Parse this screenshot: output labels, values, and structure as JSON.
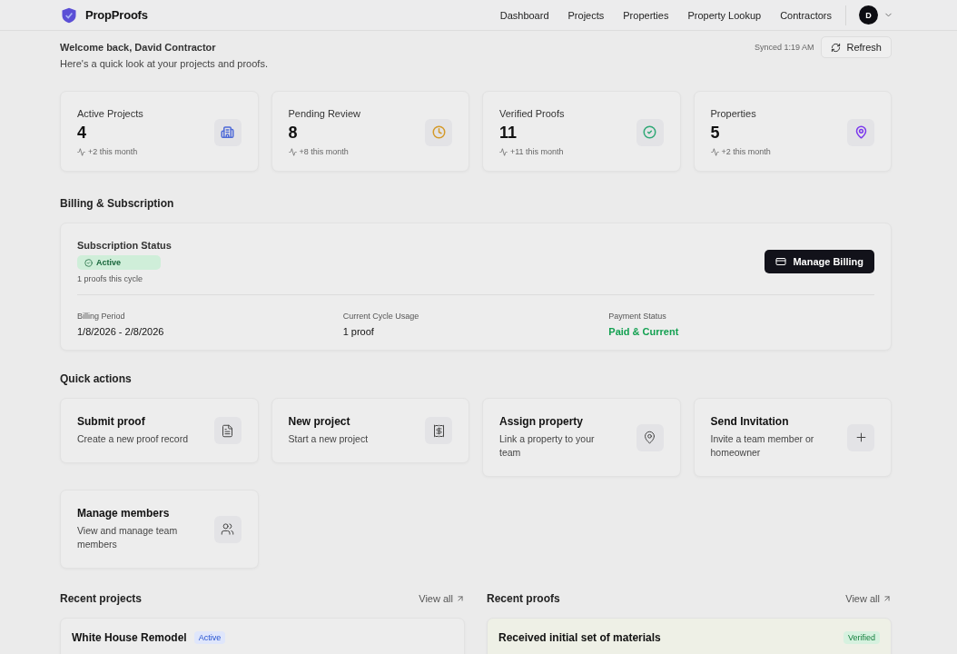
{
  "brand": "PropProofs",
  "nav": [
    {
      "label": "Dashboard"
    },
    {
      "label": "Projects"
    },
    {
      "label": "Properties"
    },
    {
      "label": "Property Lookup"
    },
    {
      "label": "Contractors"
    }
  ],
  "avatar": "D",
  "welcome": {
    "title": "Welcome back, David Contractor",
    "subtitle": "Here's a quick look at your projects and proofs.",
    "synced": "Synced 1:19 AM",
    "refresh": "Refresh"
  },
  "stats": [
    {
      "label": "Active Projects",
      "value": "4",
      "delta": "+2 this month",
      "kind": "building",
      "color": "#4f6bd8"
    },
    {
      "label": "Pending Review",
      "value": "8",
      "delta": "+8 this month",
      "kind": "clock",
      "color": "#d49a2a"
    },
    {
      "label": "Verified Proofs",
      "value": "11",
      "delta": "+11 this month",
      "kind": "check",
      "color": "#2fa876"
    },
    {
      "label": "Properties",
      "value": "5",
      "delta": "+2 this month",
      "kind": "pin",
      "color": "#7c3aed"
    }
  ],
  "billing": {
    "heading": "Billing & Subscription",
    "status_label": "Subscription Status",
    "status": "Active",
    "cycle_note": "1 proofs this cycle",
    "button": "Manage Billing",
    "fields": [
      {
        "label": "Billing Period",
        "value": "1/8/2026 - 2/8/2026",
        "kind": "plain"
      },
      {
        "label": "Current Cycle Usage",
        "value": "1 proof",
        "kind": "plain"
      },
      {
        "label": "Payment Status",
        "value": "Paid & Current",
        "kind": "good"
      }
    ]
  },
  "quick_actions": {
    "heading": "Quick actions",
    "items": [
      {
        "title": "Submit proof",
        "text": "Create a new proof record",
        "kind": "file"
      },
      {
        "title": "New project",
        "text": "Start a new project",
        "kind": "receipt"
      },
      {
        "title": "Assign property",
        "text": "Link a property to your team",
        "kind": "pin"
      },
      {
        "title": "Send Invitation",
        "text": "Invite a team member or homeowner",
        "kind": "plus"
      },
      {
        "title": "Manage members",
        "text": "View and manage team members",
        "kind": "users"
      }
    ]
  },
  "recent_projects": {
    "heading": "Recent projects",
    "view_all": "View all",
    "rows": [
      {
        "title": "White House Remodel",
        "badge": "Active"
      }
    ]
  },
  "recent_proofs": {
    "heading": "Recent proofs",
    "view_all": "View all",
    "rows": [
      {
        "title": "Received initial set of materials",
        "badge": "Verified"
      }
    ]
  }
}
